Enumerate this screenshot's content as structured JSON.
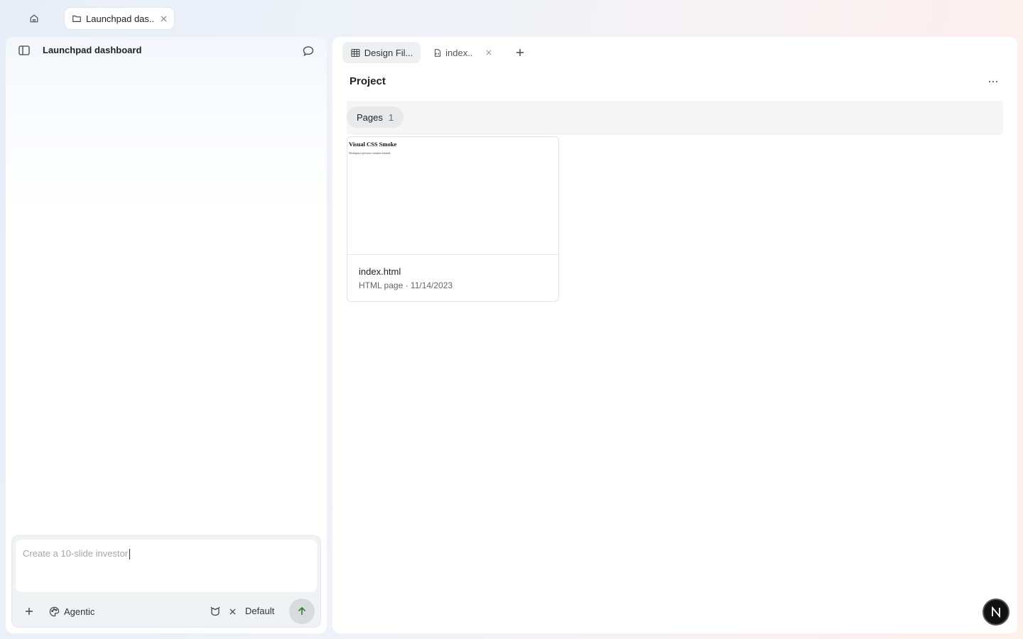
{
  "topbar": {
    "home_icon": "home-icon",
    "tab": {
      "label": "Launchpad das...",
      "icon": "folder-icon"
    }
  },
  "left_panel": {
    "title": "Launchpad dashboard",
    "composer": {
      "typed_text": "Create a 10-slide investor",
      "mode_label": "Agentic",
      "model_label": "Default"
    }
  },
  "right_panel": {
    "tabs": [
      {
        "label": "Design Fil...",
        "icon": "table-icon",
        "active": true
      },
      {
        "label": "index....",
        "icon": "html-file-icon",
        "active": false
      }
    ],
    "section_title": "Project",
    "filter": {
      "label": "Pages",
      "count": "1"
    },
    "files": [
      {
        "name": "index.html",
        "meta": "HTML page · 11/14/2023",
        "preview_title": "Visual CSS Smoke",
        "preview_subtitle": "Workspace preview contains framed."
      }
    ]
  },
  "badge": {
    "letter": "N"
  },
  "colors": {
    "send_arrow": "#2e7d32",
    "badge_bg": "#111111"
  }
}
